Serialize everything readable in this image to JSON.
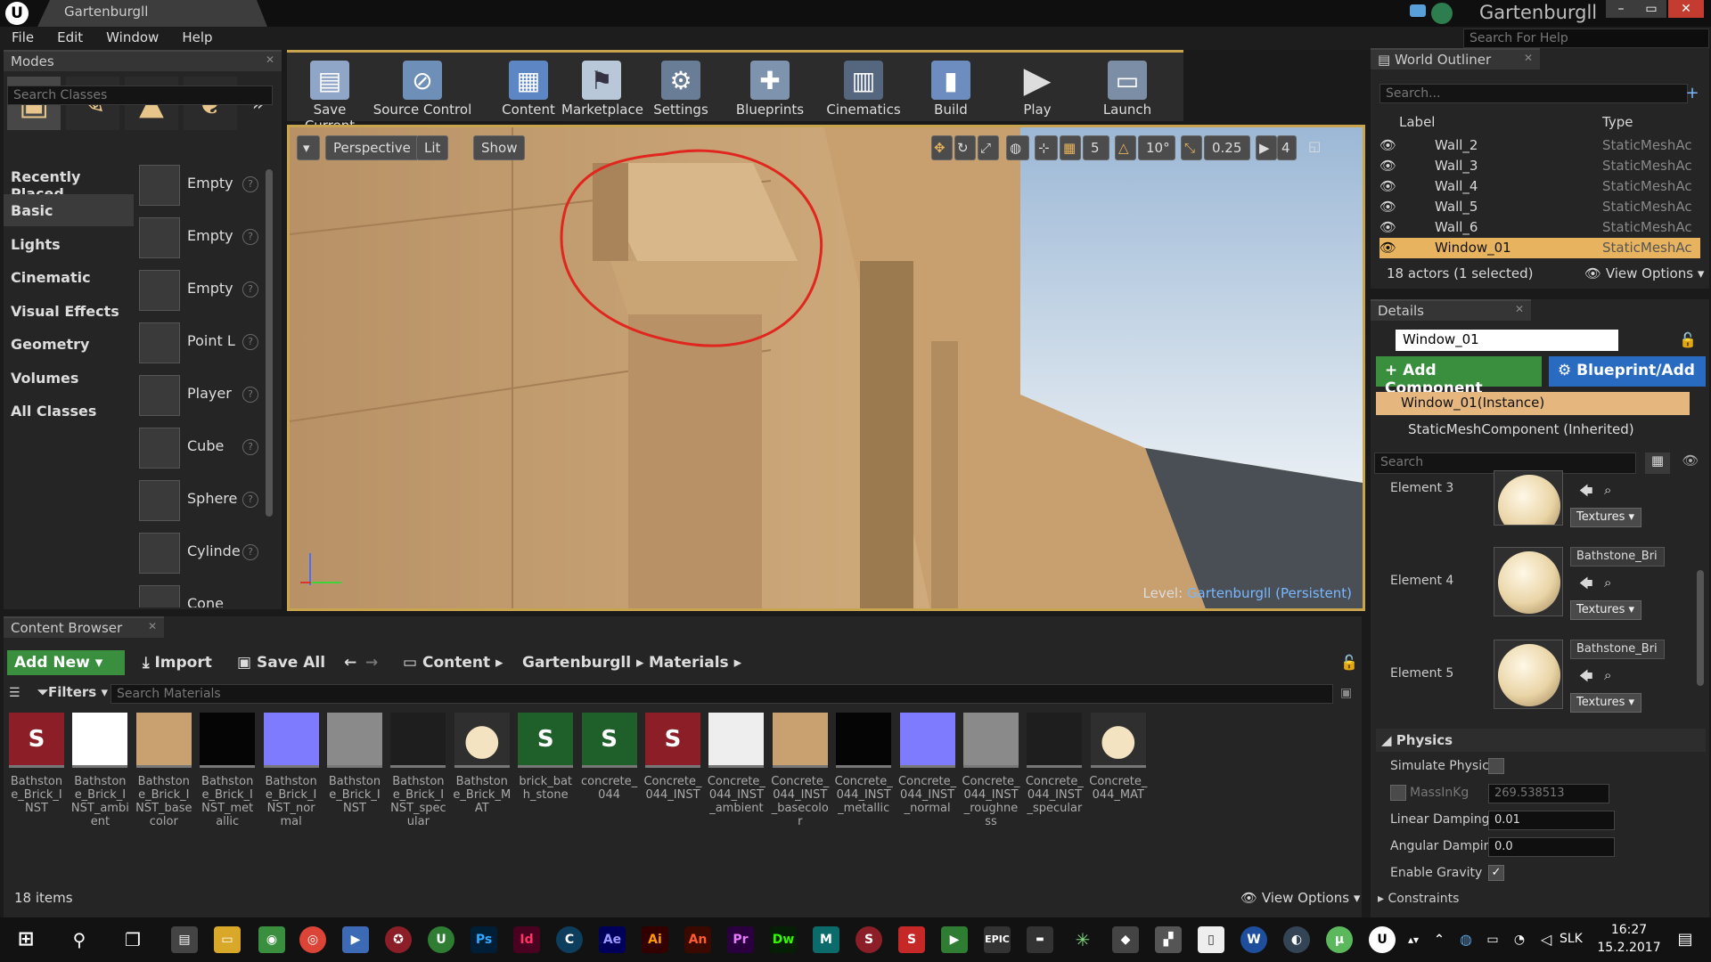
{
  "window": {
    "logo": "U",
    "tab_title": "Gartenburgll",
    "project_name": "Gartenburgll",
    "controls": [
      "–",
      "▭",
      "✕"
    ]
  },
  "menu": [
    "File",
    "Edit",
    "Window",
    "Help"
  ],
  "help_search_placeholder": "Search For Help",
  "modes": {
    "tab": "Modes",
    "search_placeholder": "Search Classes",
    "categories": [
      "Recently Placed",
      "Basic",
      "Lights",
      "Cinematic",
      "Visual Effects",
      "Geometry",
      "Volumes",
      "All Classes"
    ],
    "selected_category": "Basic",
    "items": [
      "Empty",
      "Empty",
      "Empty",
      "Point L",
      "Player",
      "Cube",
      "Sphere",
      "Cylinde",
      "Cone"
    ]
  },
  "toolbar": [
    "Save Current",
    "Source Control",
    "Content",
    "Marketplace",
    "Settings",
    "Blueprints",
    "Cinematics",
    "Build",
    "Play",
    "Launch"
  ],
  "viewport": {
    "view_mode": "Perspective",
    "lighting": "Lit",
    "show": "Show",
    "grid_snap": "5",
    "rot_snap": "10°",
    "scale_snap": "0.25",
    "cam_speed": "4",
    "level_prefix": "Level:",
    "level_name": "Gartenburgll (Persistent)"
  },
  "outliner": {
    "tab": "World Outliner",
    "search_placeholder": "Search...",
    "col_label": "Label",
    "col_type": "Type",
    "rows": [
      {
        "name": "Wall_2",
        "type": "StaticMeshAc"
      },
      {
        "name": "Wall_3",
        "type": "StaticMeshAc"
      },
      {
        "name": "Wall_4",
        "type": "StaticMeshAc"
      },
      {
        "name": "Wall_5",
        "type": "StaticMeshAc"
      },
      {
        "name": "Wall_6",
        "type": "StaticMeshAc"
      },
      {
        "name": "Window_01",
        "type": "StaticMeshAc"
      }
    ],
    "selected": "Window_01",
    "status": "18 actors (1 selected)",
    "view_options": "View Options"
  },
  "details": {
    "tab": "Details",
    "name": "Window_01",
    "add_component": "Add Component",
    "blueprint_add": "Blueprint/Add",
    "instance": "Window_01(Instance)",
    "inherited": "StaticMeshComponent (Inherited)",
    "search_placeholder": "Search",
    "elements": [
      {
        "label": "Element 3",
        "material": ""
      },
      {
        "label": "Element 4",
        "material": "Bathstone_Bri"
      },
      {
        "label": "Element 5",
        "material": "Bathstone_Bri"
      }
    ],
    "textures_btn": "Textures",
    "physics_header": "Physics",
    "simulate_physics": "Simulate Physic",
    "simulate_physics_checked": false,
    "mass_label": "MassInKg",
    "mass_value": "269.538513",
    "linear_damping_label": "Linear Damping",
    "linear_damping": "0.01",
    "angular_damping_label": "Angular Damping",
    "angular_damping": "0.0",
    "enable_gravity": "Enable Gravity",
    "enable_gravity_checked": true,
    "constraints": "Constraints"
  },
  "content_browser": {
    "tab": "Content Browser",
    "add_new": "Add New",
    "import": "Import",
    "save_all": "Save All",
    "path": [
      "Content",
      "Gartenburgll",
      "Materials"
    ],
    "filters": "Filters",
    "search_placeholder": "Search Materials",
    "assets": [
      {
        "name": "Bathstone_Brick_INST",
        "thumb": "#8b1e26",
        "glyph": "S"
      },
      {
        "name": "Bathstone_Brick_INST_ambient",
        "thumb": "#ffffff",
        "glyph": ""
      },
      {
        "name": "Bathstone_Brick_INST_basecolor",
        "thumb": "#c9a070",
        "glyph": ""
      },
      {
        "name": "Bathstone_Brick_INST_metallic",
        "thumb": "#050505",
        "glyph": ""
      },
      {
        "name": "Bathstone_Brick_INST_normal",
        "thumb": "#7f7bff",
        "glyph": ""
      },
      {
        "name": "Bathstone_Brick_INST",
        "thumb": "#8a8a8a",
        "glyph": ""
      },
      {
        "name": "Bathstone_Brick_INST_specular",
        "thumb": "#1e1e1e",
        "glyph": ""
      },
      {
        "name": "Bathstone_Brick_MAT",
        "thumb": "#2f2f2f",
        "glyph": "●"
      },
      {
        "name": "brick_bath_stone",
        "thumb": "#1f5f29",
        "glyph": "S"
      },
      {
        "name": "concrete_044",
        "thumb": "#1f5f29",
        "glyph": "S"
      },
      {
        "name": "Concrete_044_INST",
        "thumb": "#8b1e26",
        "glyph": "S"
      },
      {
        "name": "Concrete_044_INST_ambient",
        "thumb": "#eeeeee",
        "glyph": ""
      },
      {
        "name": "Concrete_044_INST_basecolor",
        "thumb": "#c9a070",
        "glyph": ""
      },
      {
        "name": "Concrete_044_INST_metallic",
        "thumb": "#050505",
        "glyph": ""
      },
      {
        "name": "Concrete_044_INST_normal",
        "thumb": "#7f7bff",
        "glyph": ""
      },
      {
        "name": "Concrete_044_INST_roughness",
        "thumb": "#8a8a8a",
        "glyph": ""
      },
      {
        "name": "Concrete_044_INST_specular",
        "thumb": "#1e1e1e",
        "glyph": ""
      },
      {
        "name": "Concrete_044_MAT",
        "thumb": "#2f2f2f",
        "glyph": "●"
      }
    ],
    "count": "18 items",
    "view_options": "View Options"
  },
  "taskbar": {
    "apps": [
      "Ps",
      "Id",
      "Ae",
      "Ai",
      "An",
      "Pr",
      "Dw"
    ],
    "lang": "SLK",
    "time": "16:27",
    "date": "15.2.2017"
  },
  "colors": {
    "accent": "#c9a44e",
    "selection": "#e8b35e",
    "green": "#3a8f3e",
    "blue": "#2a6bc2"
  }
}
